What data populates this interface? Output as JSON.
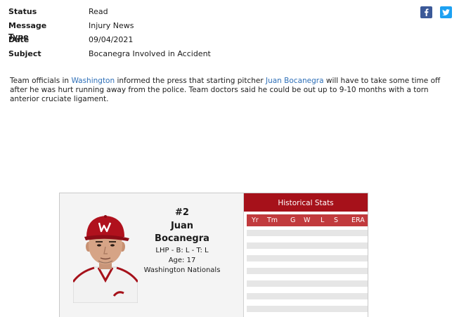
{
  "message": {
    "fields": [
      {
        "key": "Status",
        "value": "Read"
      },
      {
        "key": "Message Type",
        "value": "Injury News"
      },
      {
        "key": "Date",
        "value": "09/04/2021"
      },
      {
        "key": "Subject",
        "value": "Bocanegra Involved in Accident"
      }
    ],
    "share": {
      "facebook_icon": "facebook-icon",
      "twitter_icon": "twitter-icon"
    },
    "body": {
      "part1": "Team officials in ",
      "link_team": "Washington",
      "part2": " informed the press that starting pitcher ",
      "link_player": "Juan Bocanegra",
      "part3": " will have to take some time off after he was hurt running away from the police. Team doctors said he could be out up to 9-10 months with a torn anterior cruciate ligament."
    }
  },
  "player_card": {
    "number": "#2",
    "first_name": "Juan",
    "last_name": "Bocanegra",
    "handedness": "LHP - B: L - T: L",
    "age": "Age: 17",
    "team": "Washington Nationals",
    "historical_stats": {
      "title": "Historical Stats",
      "columns": [
        "Yr",
        "Tm",
        "G",
        "W",
        "L",
        "S",
        "ERA"
      ],
      "rows": []
    }
  },
  "colors": {
    "link": "#2e6fb7",
    "stats_header": "#a6111a",
    "stats_columns": "#c13a3d",
    "facebook": "#3b5998",
    "twitter": "#1da1f2"
  }
}
